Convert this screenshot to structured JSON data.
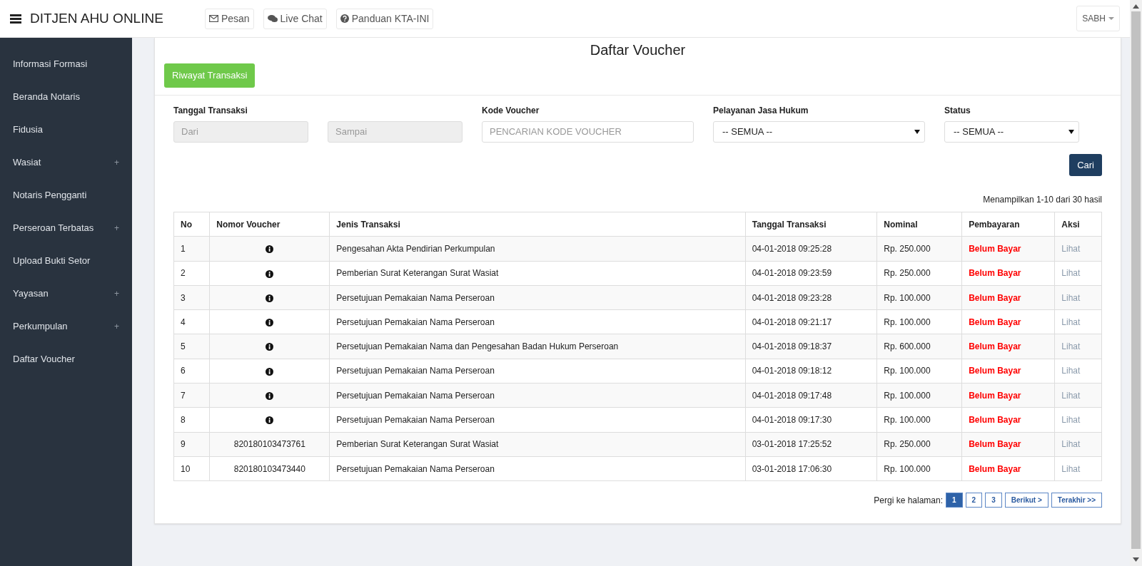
{
  "navbar": {
    "brand": "DITJEN AHU ONLINE",
    "links": [
      {
        "label": "Pesan"
      },
      {
        "label": "Live Chat"
      },
      {
        "label": "Panduan KTA-INI"
      }
    ],
    "user": "SABH"
  },
  "sidebar": {
    "items": [
      {
        "label": "Informasi Formasi"
      },
      {
        "label": "Beranda Notaris"
      },
      {
        "label": "Fidusia"
      },
      {
        "label": "Wasiat",
        "toggle": "+"
      },
      {
        "label": "Notaris Pengganti"
      },
      {
        "label": "Perseroan Terbatas",
        "toggle": "+"
      },
      {
        "label": "Upload Bukti Setor"
      },
      {
        "label": "Yayasan",
        "toggle": "+"
      },
      {
        "label": "Perkumpulan",
        "toggle": "+"
      },
      {
        "label": "Daftar Voucher"
      }
    ]
  },
  "page": {
    "title": "Daftar Voucher",
    "history_button": "Riwayat Transaksi"
  },
  "filters": {
    "date_label": "Tanggal Transaksi",
    "from_placeholder": "Dari",
    "to_placeholder": "Sampai",
    "code_label": "Kode Voucher",
    "code_placeholder": "PENCARIAN KODE VOUCHER",
    "service_label": "Pelayanan Jasa Hukum",
    "service_value": "-- SEMUA --",
    "status_label": "Status",
    "status_value": "-- SEMUA --",
    "search_button": "Cari"
  },
  "summary": "Menampilkan 1-10 dari 30 hasil",
  "table": {
    "columns": [
      "No",
      "Nomor Voucher",
      "Jenis Transaksi",
      "Tanggal Transaksi",
      "Nominal",
      "Pembayaran",
      "Aksi"
    ],
    "rows": [
      {
        "no": "1",
        "kind": "icon",
        "type": "Pengesahan Akta Pendirian Perkumpulan",
        "date": "04-01-2018 09:25:28",
        "amount": "Rp. 250.000",
        "payment": "Belum Bayar",
        "action": "Lihat"
      },
      {
        "no": "2",
        "kind": "icon",
        "type": "Pemberian Surat Keterangan Surat Wasiat",
        "date": "04-01-2018 09:23:59",
        "amount": "Rp. 250.000",
        "payment": "Belum Bayar",
        "action": "Lihat"
      },
      {
        "no": "3",
        "kind": "icon",
        "type": "Persetujuan Pemakaian Nama Perseroan",
        "date": "04-01-2018 09:23:28",
        "amount": "Rp. 100.000",
        "payment": "Belum Bayar",
        "action": "Lihat"
      },
      {
        "no": "4",
        "kind": "icon",
        "type": "Persetujuan Pemakaian Nama Perseroan",
        "date": "04-01-2018 09:21:17",
        "amount": "Rp. 100.000",
        "payment": "Belum Bayar",
        "action": "Lihat"
      },
      {
        "no": "5",
        "kind": "icon",
        "type": "Persetujuan Pemakaian Nama dan Pengesahan Badan Hukum Perseroan",
        "date": "04-01-2018 09:18:37",
        "amount": "Rp. 600.000",
        "payment": "Belum Bayar",
        "action": "Lihat"
      },
      {
        "no": "6",
        "kind": "icon",
        "type": "Persetujuan Pemakaian Nama Perseroan",
        "date": "04-01-2018 09:18:12",
        "amount": "Rp. 100.000",
        "payment": "Belum Bayar",
        "action": "Lihat"
      },
      {
        "no": "7",
        "kind": "icon",
        "type": "Persetujuan Pemakaian Nama Perseroan",
        "date": "04-01-2018 09:17:48",
        "amount": "Rp. 100.000",
        "payment": "Belum Bayar",
        "action": "Lihat"
      },
      {
        "no": "8",
        "kind": "icon",
        "type": "Persetujuan Pemakaian Nama Perseroan",
        "date": "04-01-2018 09:17:30",
        "amount": "Rp. 100.000",
        "payment": "Belum Bayar",
        "action": "Lihat"
      },
      {
        "no": "9",
        "kind": "text",
        "voucher": "820180103473761",
        "type": "Pemberian Surat Keterangan Surat Wasiat",
        "date": "03-01-2018 17:25:52",
        "amount": "Rp. 250.000",
        "payment": "Belum Bayar",
        "action": "Lihat"
      },
      {
        "no": "10",
        "kind": "text",
        "voucher": "820180103473440",
        "type": "Persetujuan Pemakaian Nama Perseroan",
        "date": "03-01-2018 17:06:30",
        "amount": "Rp. 100.000",
        "payment": "Belum Bayar",
        "action": "Lihat"
      }
    ]
  },
  "pagination": {
    "label": "Pergi ke halaman:",
    "pages": [
      {
        "label": "1",
        "selected": true
      },
      {
        "label": "2",
        "selected": false
      },
      {
        "label": "3",
        "selected": false
      }
    ],
    "next": "Berikut >",
    "last": "Terakhir >>"
  }
}
